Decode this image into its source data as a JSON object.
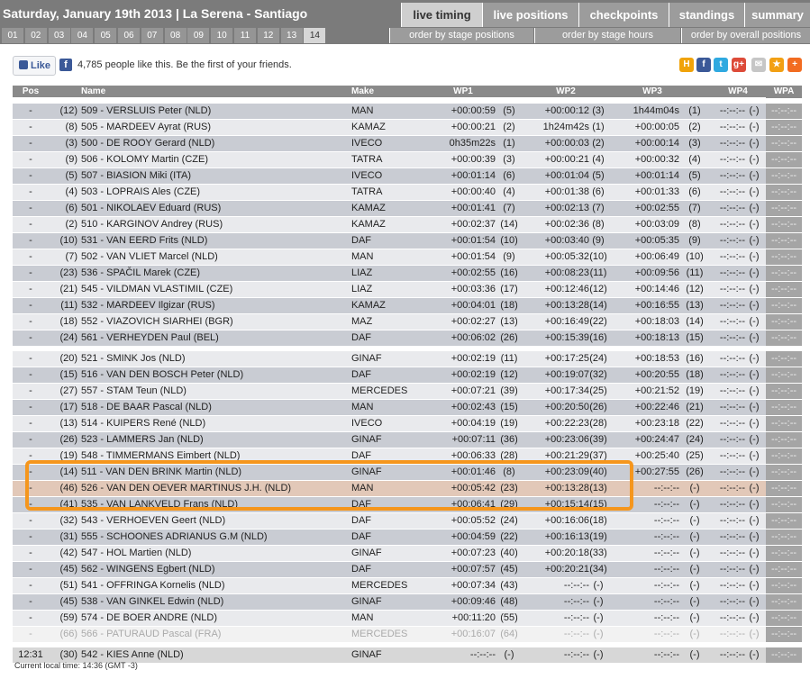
{
  "header": {
    "title": "Saturday, January 19th 2013 | La Serena - Santiago",
    "tabs": [
      {
        "label": "live timing",
        "active": true
      },
      {
        "label": "live positions"
      },
      {
        "label": "checkpoints"
      },
      {
        "label": "standings"
      },
      {
        "label": "summary"
      }
    ]
  },
  "stages": [
    "01",
    "02",
    "03",
    "04",
    "05",
    "06",
    "07",
    "08",
    "09",
    "10",
    "11",
    "12",
    "13",
    "14"
  ],
  "active_stage": "14",
  "order_buttons": [
    "order by stage positions",
    "order by stage hours",
    "order by overall positions"
  ],
  "social": {
    "like_label": "Like",
    "like_text": "4,785 people like this. Be the first of your friends."
  },
  "columns": {
    "pos": "Pos",
    "name": "Name",
    "make": "Make",
    "wp1": "WP1",
    "wp2": "WP2",
    "wp3": "WP3",
    "wp4": "WP4",
    "wpa": "WPA"
  },
  "rows": [
    [
      "-",
      "(12)",
      "509 - VERSLUIS Peter (NLD)",
      "MAN",
      "+00:00:59",
      "(5)",
      "+00:00:12",
      "(3)",
      "1h44m04s",
      "(1)",
      "--:--:--",
      "(-)",
      "--:--:--"
    ],
    [
      "-",
      "(8)",
      "505 - MARDEEV Ayrat (RUS)",
      "KAMAZ",
      "+00:00:21",
      "(2)",
      "1h24m42s",
      "(1)",
      "+00:00:05",
      "(2)",
      "--:--:--",
      "(-)",
      "--:--:--"
    ],
    [
      "-",
      "(3)",
      "500 - DE ROOY Gerard (NLD)",
      "IVECO",
      "0h35m22s",
      "(1)",
      "+00:00:03",
      "(2)",
      "+00:00:14",
      "(3)",
      "--:--:--",
      "(-)",
      "--:--:--"
    ],
    [
      "-",
      "(9)",
      "506 - KOLOMY Martin (CZE)",
      "TATRA",
      "+00:00:39",
      "(3)",
      "+00:00:21",
      "(4)",
      "+00:00:32",
      "(4)",
      "--:--:--",
      "(-)",
      "--:--:--"
    ],
    [
      "-",
      "(5)",
      "507 - BIASION Miki (ITA)",
      "IVECO",
      "+00:01:14",
      "(6)",
      "+00:01:04",
      "(5)",
      "+00:01:14",
      "(5)",
      "--:--:--",
      "(-)",
      "--:--:--"
    ],
    [
      "-",
      "(4)",
      "503 - LOPRAIS Ales (CZE)",
      "TATRA",
      "+00:00:40",
      "(4)",
      "+00:01:38",
      "(6)",
      "+00:01:33",
      "(6)",
      "--:--:--",
      "(-)",
      "--:--:--"
    ],
    [
      "-",
      "(6)",
      "501 - NIKOLAEV Eduard (RUS)",
      "KAMAZ",
      "+00:01:41",
      "(7)",
      "+00:02:13",
      "(7)",
      "+00:02:55",
      "(7)",
      "--:--:--",
      "(-)",
      "--:--:--"
    ],
    [
      "-",
      "(2)",
      "510 - KARGINOV Andrey (RUS)",
      "KAMAZ",
      "+00:02:37",
      "(14)",
      "+00:02:36",
      "(8)",
      "+00:03:09",
      "(8)",
      "--:--:--",
      "(-)",
      "--:--:--"
    ],
    [
      "-",
      "(10)",
      "531 - VAN EERD Frits (NLD)",
      "DAF",
      "+00:01:54",
      "(10)",
      "+00:03:40",
      "(9)",
      "+00:05:35",
      "(9)",
      "--:--:--",
      "(-)",
      "--:--:--"
    ],
    [
      "-",
      "(7)",
      "502 - VAN VLIET Marcel (NLD)",
      "MAN",
      "+00:01:54",
      "(9)",
      "+00:05:32",
      "(10)",
      "+00:06:49",
      "(10)",
      "--:--:--",
      "(-)",
      "--:--:--"
    ],
    [
      "-",
      "(23)",
      "536 - SPAČIL Marek (CZE)",
      "LIAZ",
      "+00:02:55",
      "(16)",
      "+00:08:23",
      "(11)",
      "+00:09:56",
      "(11)",
      "--:--:--",
      "(-)",
      "--:--:--"
    ],
    [
      "-",
      "(21)",
      "545 - VILDMAN VLASTIMIL (CZE)",
      "LIAZ",
      "+00:03:36",
      "(17)",
      "+00:12:46",
      "(12)",
      "+00:14:46",
      "(12)",
      "--:--:--",
      "(-)",
      "--:--:--"
    ],
    [
      "-",
      "(11)",
      "532 - MARDEEV Ilgizar (RUS)",
      "KAMAZ",
      "+00:04:01",
      "(18)",
      "+00:13:28",
      "(14)",
      "+00:16:55",
      "(13)",
      "--:--:--",
      "(-)",
      "--:--:--"
    ],
    [
      "-",
      "(18)",
      "552 - VIAZOVICH SIARHEI (BGR)",
      "MAZ",
      "+00:02:27",
      "(13)",
      "+00:16:49",
      "(22)",
      "+00:18:03",
      "(14)",
      "--:--:--",
      "(-)",
      "--:--:--"
    ],
    [
      "-",
      "(24)",
      "561 - VERHEYDEN Paul (BEL)",
      "DAF",
      "+00:06:02",
      "(26)",
      "+00:15:39",
      "(16)",
      "+00:18:13",
      "(15)",
      "--:--:--",
      "(-)",
      "--:--:--"
    ],
    [
      "-",
      "(20)",
      "521 - SMINK Jos (NLD)",
      "GINAF",
      "+00:02:19",
      "(11)",
      "+00:17:25",
      "(24)",
      "+00:18:53",
      "(16)",
      "--:--:--",
      "(-)",
      "--:--:--"
    ],
    [
      "-",
      "(15)",
      "516 - VAN DEN BOSCH Peter (NLD)",
      "DAF",
      "+00:02:19",
      "(12)",
      "+00:19:07",
      "(32)",
      "+00:20:55",
      "(18)",
      "--:--:--",
      "(-)",
      "--:--:--"
    ],
    [
      "-",
      "(27)",
      "557 - STAM Teun (NLD)",
      "MERCEDES",
      "+00:07:21",
      "(39)",
      "+00:17:34",
      "(25)",
      "+00:21:52",
      "(19)",
      "--:--:--",
      "(-)",
      "--:--:--"
    ],
    [
      "-",
      "(17)",
      "518 - DE BAAR Pascal (NLD)",
      "MAN",
      "+00:02:43",
      "(15)",
      "+00:20:50",
      "(26)",
      "+00:22:46",
      "(21)",
      "--:--:--",
      "(-)",
      "--:--:--"
    ],
    [
      "-",
      "(13)",
      "514 - KUIPERS René (NLD)",
      "IVECO",
      "+00:04:19",
      "(19)",
      "+00:22:23",
      "(28)",
      "+00:23:18",
      "(22)",
      "--:--:--",
      "(-)",
      "--:--:--"
    ],
    [
      "-",
      "(26)",
      "523 - LAMMERS Jan (NLD)",
      "GINAF",
      "+00:07:11",
      "(36)",
      "+00:23:06",
      "(39)",
      "+00:24:47",
      "(24)",
      "--:--:--",
      "(-)",
      "--:--:--"
    ],
    [
      "-",
      "(19)",
      "548 - TIMMERMANS Eimbert (NLD)",
      "DAF",
      "+00:06:33",
      "(28)",
      "+00:21:29",
      "(37)",
      "+00:25:40",
      "(25)",
      "--:--:--",
      "(-)",
      "--:--:--"
    ],
    [
      "-",
      "(14)",
      "511 - VAN DEN BRINK Martin (NLD)",
      "GINAF",
      "+00:01:46",
      "(8)",
      "+00:23:09",
      "(40)",
      "+00:27:55",
      "(26)",
      "--:--:--",
      "(-)",
      "--:--:--"
    ],
    [
      "-",
      "(46)",
      "526 - VAN DEN OEVER MARTINUS J.H. (NLD)",
      "MAN",
      "+00:05:42",
      "(23)",
      "+00:13:28",
      "(13)",
      "--:--:--",
      "(-)",
      "--:--:--",
      "(-)",
      "--:--:--"
    ],
    [
      "-",
      "(41)",
      "535 - VAN LANKVELD Frans (NLD)",
      "DAF",
      "+00:06:41",
      "(29)",
      "+00:15:14",
      "(15)",
      "--:--:--",
      "(-)",
      "--:--:--",
      "(-)",
      "--:--:--"
    ],
    [
      "-",
      "(32)",
      "543 - VERHOEVEN Geert (NLD)",
      "DAF",
      "+00:05:52",
      "(24)",
      "+00:16:06",
      "(18)",
      "--:--:--",
      "(-)",
      "--:--:--",
      "(-)",
      "--:--:--"
    ],
    [
      "-",
      "(31)",
      "555 - SCHOONES ADRIANUS G.M (NLD)",
      "DAF",
      "+00:04:59",
      "(22)",
      "+00:16:13",
      "(19)",
      "--:--:--",
      "(-)",
      "--:--:--",
      "(-)",
      "--:--:--"
    ],
    [
      "-",
      "(42)",
      "547 - HOL Martien (NLD)",
      "GINAF",
      "+00:07:23",
      "(40)",
      "+00:20:18",
      "(33)",
      "--:--:--",
      "(-)",
      "--:--:--",
      "(-)",
      "--:--:--"
    ],
    [
      "-",
      "(45)",
      "562 - WINGENS Egbert (NLD)",
      "DAF",
      "+00:07:57",
      "(45)",
      "+00:20:21",
      "(34)",
      "--:--:--",
      "(-)",
      "--:--:--",
      "(-)",
      "--:--:--"
    ],
    [
      "-",
      "(51)",
      "541 - OFFRINGA Kornelis (NLD)",
      "MERCEDES",
      "+00:07:34",
      "(43)",
      "--:--:--",
      "(-)",
      "--:--:--",
      "(-)",
      "--:--:--",
      "(-)",
      "--:--:--"
    ],
    [
      "-",
      "(45)",
      "538 - VAN GINKEL Edwin (NLD)",
      "GINAF",
      "+00:09:46",
      "(48)",
      "--:--:--",
      "(-)",
      "--:--:--",
      "(-)",
      "--:--:--",
      "(-)",
      "--:--:--"
    ],
    [
      "-",
      "(59)",
      "574 - DE BOER ANDRE (NLD)",
      "MAN",
      "+00:11:20",
      "(55)",
      "--:--:--",
      "(-)",
      "--:--:--",
      "(-)",
      "--:--:--",
      "(-)",
      "--:--:--"
    ],
    [
      "-",
      "(66)",
      "566 - PATURAUD Pascal (FRA)",
      "MERCEDES",
      "+00:16:07",
      "(64)",
      "--:--:--",
      "(-)",
      "--:--:--",
      "(-)",
      "--:--:--",
      "(-)",
      "--:--:--"
    ],
    [
      "12:31",
      "(30)",
      "542 - KIES Anne (NLD)",
      "GINAF",
      "--:--:--",
      "(-)",
      "--:--:--",
      "(-)",
      "--:--:--",
      "(-)",
      "--:--:--",
      "(-)",
      "--:--:--"
    ]
  ],
  "footer": {
    "local_time": "Current local time: 14:36 (GMT -3)"
  }
}
